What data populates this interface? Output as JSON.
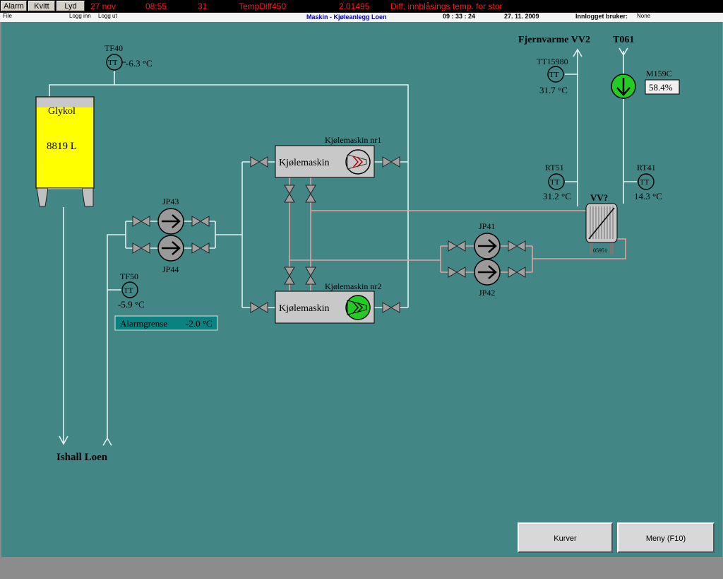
{
  "topbar": {
    "buttons": {
      "alarm": "Alarm",
      "kvitt": "Kvitt",
      "lyd": "Lyd"
    },
    "alarm": {
      "date": "27 nov",
      "time": "08:55",
      "number": "31",
      "tag": "TempDiff450",
      "value": "2.01495",
      "message": "Diff. innblåsings temp. for stor"
    }
  },
  "infobar": {
    "file": "File",
    "login": "Logg inn",
    "logout": "Logg ut",
    "title": "Maskin - Kjøleanlegg Loen",
    "time": "09 : 33 : 24",
    "date": "27. 11. 2009",
    "user_label": "Innlogget bruker:",
    "user_value": "None"
  },
  "diagram": {
    "tank": {
      "name": "Glykol",
      "volume": "8819 L"
    },
    "tf40": {
      "name": "TF40",
      "value": "-6.3 °C"
    },
    "tf50": {
      "name": "TF50",
      "value": "-5.9 °C"
    },
    "alarm_limit": {
      "label": "Alarmgrense",
      "value": "-2.0 °C"
    },
    "pumps": {
      "jp43": "JP43",
      "jp44": "JP44",
      "jp41": "JP41",
      "jp42": "JP42"
    },
    "chiller1": {
      "title": "Kjølemaskin nr1",
      "label": "Kjølemaskin"
    },
    "chiller2": {
      "title": "Kjølemaskin nr2",
      "label": "Kjølemaskin"
    },
    "fjernvarme": "Fjernvarme VV2",
    "t061": "T061",
    "tt15980": {
      "name": "TT15980",
      "value": "31.7 °C"
    },
    "m159c": {
      "name": "M159C",
      "value": "58.4%"
    },
    "rt51": {
      "name": "RT51",
      "value": "31.2 °C"
    },
    "rt41": {
      "name": "RT41",
      "value": "14.3 °C"
    },
    "hx": {
      "name": "VV?",
      "id": "05951"
    },
    "ishall": "Ishall Loen",
    "sensor_symbol": "TT"
  },
  "buttons": {
    "kurver": "Kurver",
    "meny": "Meny (F10)"
  },
  "colors": {
    "background": "#438686",
    "tank": "#ffff00",
    "running": "#22cc22",
    "stopped": "#9a9a9a",
    "hot_pipe": "#e8a0a0",
    "cold_pipe": "#dff0f0"
  }
}
